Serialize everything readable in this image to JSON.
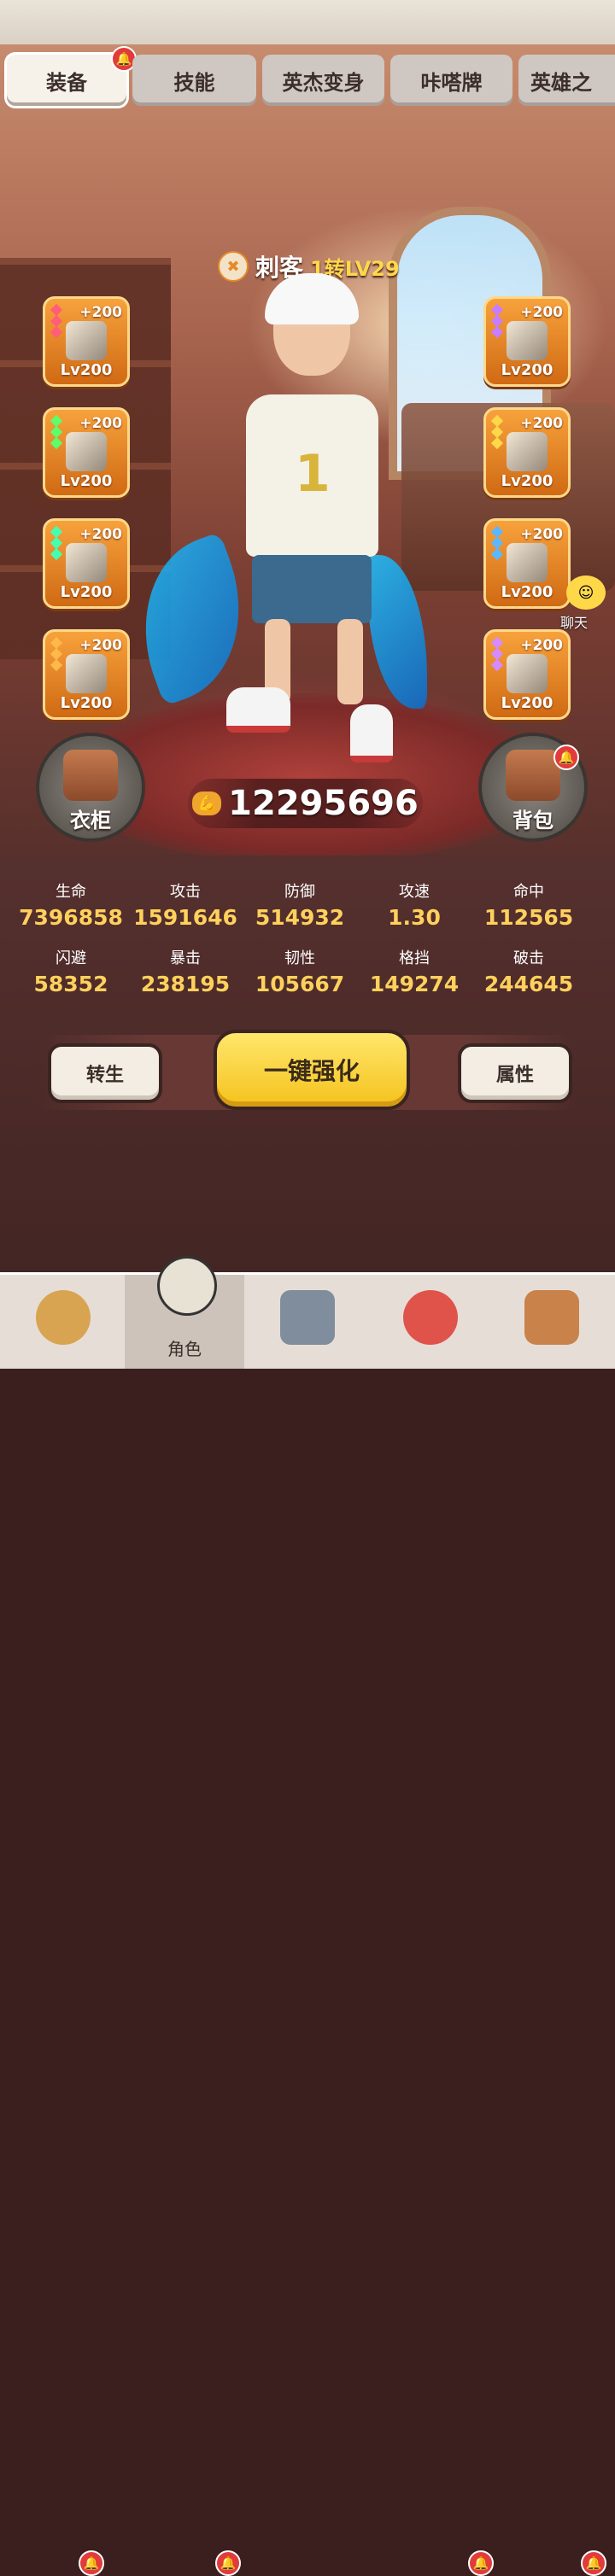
{
  "tabs": [
    {
      "label": "装备",
      "active": true,
      "badge": true
    },
    {
      "label": "技能",
      "active": false
    },
    {
      "label": "英杰变身",
      "active": false
    },
    {
      "label": "咔嗒牌",
      "active": false
    },
    {
      "label": "英雄之",
      "active": false
    }
  ],
  "character": {
    "class_name": "刺客",
    "rank": "1转LV29",
    "jersey_number": "1"
  },
  "left_slots": [
    {
      "plus": "+200",
      "level": "Lv200",
      "gem_color": "#ff5d7a",
      "icon": "spear-icon"
    },
    {
      "plus": "+200",
      "level": "Lv200",
      "gem_color": "#5cff6b",
      "icon": "gauntlet-icon"
    },
    {
      "plus": "+200",
      "level": "Lv200",
      "gem_color": "#45ffb0",
      "icon": "shoulder-icon"
    },
    {
      "plus": "+200",
      "level": "Lv200",
      "gem_color": "#ffb84a",
      "icon": "ring-icon"
    }
  ],
  "right_slots": [
    {
      "plus": "+200",
      "level": "Lv200",
      "gem_color": "#c87cff",
      "icon": "spear-icon"
    },
    {
      "plus": "+200",
      "level": "Lv200",
      "gem_color": "#ffd84a",
      "icon": "armor-icon"
    },
    {
      "plus": "+200",
      "level": "Lv200",
      "gem_color": "#5ab8ff",
      "icon": "boots-icon"
    },
    {
      "plus": "+200",
      "level": "Lv200",
      "gem_color": "#d58bff",
      "icon": "necklace-icon"
    }
  ],
  "chat": {
    "label": "聊天"
  },
  "wardrobe": {
    "label": "衣柜"
  },
  "backpack": {
    "label": "背包",
    "badge": true
  },
  "power": {
    "value": "12295696",
    "icon": "muscle-icon"
  },
  "stats": [
    {
      "name": "生命",
      "value": "7396858"
    },
    {
      "name": "攻击",
      "value": "1591646"
    },
    {
      "name": "防御",
      "value": "514932"
    },
    {
      "name": "攻速",
      "value": "1.30"
    },
    {
      "name": "命中",
      "value": "112565"
    },
    {
      "name": "闪避",
      "value": "58352"
    },
    {
      "name": "暴击",
      "value": "238195"
    },
    {
      "name": "韧性",
      "value": "105667"
    },
    {
      "name": "格挡",
      "value": "149274"
    },
    {
      "name": "破击",
      "value": "244645"
    }
  ],
  "buttons": {
    "rebirth": "转生",
    "enhance_all": "一键强化",
    "attributes": "属性"
  },
  "bottom_nav": [
    {
      "label": "",
      "icon": "warrior-icon",
      "badge": true,
      "active": false
    },
    {
      "label": "角色",
      "icon": "character-icon",
      "badge": true,
      "active": true
    },
    {
      "label": "",
      "icon": "sword-shield-icon",
      "badge": false,
      "active": false
    },
    {
      "label": "",
      "icon": "pet-icon",
      "badge": true,
      "active": false
    },
    {
      "label": "",
      "icon": "guild-icon",
      "badge": true,
      "active": false
    }
  ],
  "colors": {
    "slot_orange": "#f7a23c",
    "stat_value": "#ffd15c",
    "enhance_yellow": "#ffe66b",
    "badge_red": "#e23b3b"
  }
}
